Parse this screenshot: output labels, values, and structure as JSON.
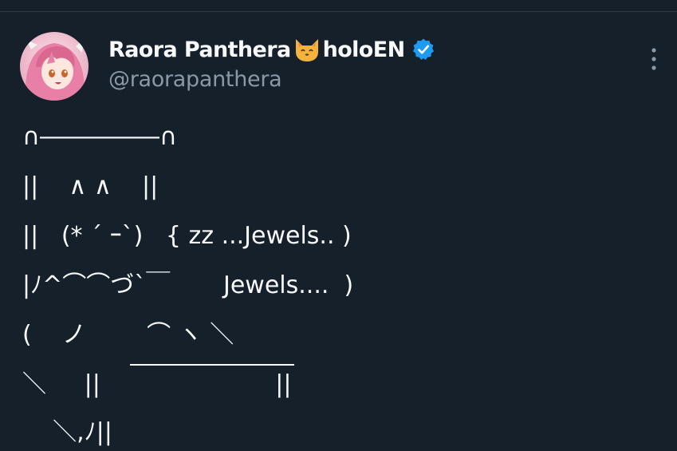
{
  "author": {
    "display_name": "Raora Panthera",
    "display_name_suffix": "holoEN",
    "name_emoji": "cat-face-icon",
    "verified_badge": "verified-icon",
    "handle": "@raorapanthera",
    "avatar": "avatar-icon"
  },
  "menu": {
    "more_icon": "more-vertical-icon"
  },
  "tweet": {
    "lines": [
      "∩―――――∩",
      "||    ∧ ∧    ||",
      "||   (* ´ ｰ`)   { zz ...Jewels.. )",
      "|ﾉ^⌒⌒づ`￣       Jewels....  )",
      "(    ノ        ⌒ ヽ ＼",
      "＼     ||                       ||",
      "    ＼,ﾉ||"
    ]
  },
  "colors": {
    "background": "#15202b",
    "text_primary": "#f7f9f9",
    "text_secondary": "#8b98a5",
    "verified_blue": "#1d9bf0",
    "avatar_pink": "#e87fa6"
  }
}
